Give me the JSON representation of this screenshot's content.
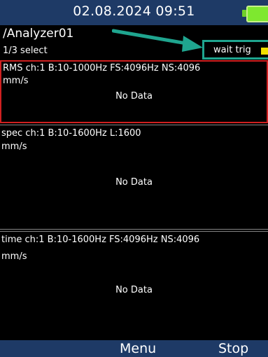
{
  "header": {
    "datetime": "02.08.2024 09:51",
    "battery_icon": "battery-full-icon",
    "battery_color": "#7ee82f"
  },
  "analyzer": {
    "title": "/Analyzer01",
    "selection": "1/3 select"
  },
  "status": {
    "label": "wait trig",
    "indicator_color": "#f0e000",
    "highlight_color": "#1fa58f"
  },
  "panels": [
    {
      "header": "RMS ch:1 B:10-1000Hz FS:4096Hz NS:4096",
      "unit": "mm/s",
      "message": "No Data",
      "selected": true
    },
    {
      "header": "spec ch:1 B:10-1600Hz L:1600",
      "unit": "mm/s",
      "message": "No Data",
      "selected": false
    },
    {
      "header": "time ch:1 B:10-1600Hz FS:4096Hz NS:4096",
      "unit": "mm/s",
      "message": "No Data",
      "selected": false
    }
  ],
  "softkeys": {
    "left": "Menu",
    "right": "Stop"
  }
}
